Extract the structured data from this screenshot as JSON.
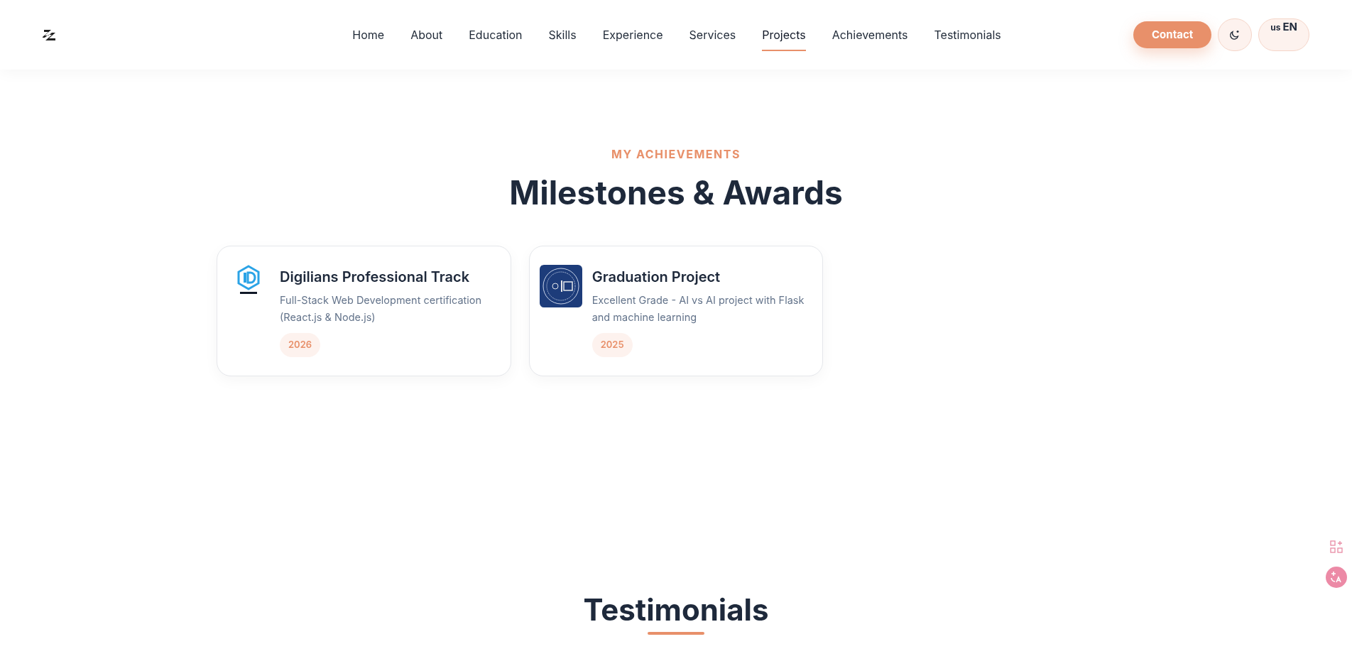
{
  "nav": {
    "items": [
      {
        "label": "Home",
        "selected": false
      },
      {
        "label": "About",
        "selected": false
      },
      {
        "label": "Education",
        "selected": false
      },
      {
        "label": "Skills",
        "selected": false
      },
      {
        "label": "Experience",
        "selected": false
      },
      {
        "label": "Services",
        "selected": false
      },
      {
        "label": "Projects",
        "selected": true
      },
      {
        "label": "Achievements",
        "selected": false
      },
      {
        "label": "Testimonials",
        "selected": false
      }
    ],
    "contact": "Contact",
    "language": {
      "flag": "us",
      "code": "EN"
    }
  },
  "achievements": {
    "eyebrow": "MY ACHIEVEMENTS",
    "title": "Milestones & Awards",
    "cards": [
      {
        "kind": "digilians",
        "title": "Digilians Professional Track",
        "description": "Full-Stack Web Development certification (React.js & Node.js)",
        "year": "2026"
      },
      {
        "kind": "eelu",
        "title": "Graduation Project",
        "description": "Excellent Grade - AI vs AI project with Flask and machine learning",
        "year": "2025"
      }
    ]
  },
  "testimonials": {
    "title": "Testimonials"
  }
}
